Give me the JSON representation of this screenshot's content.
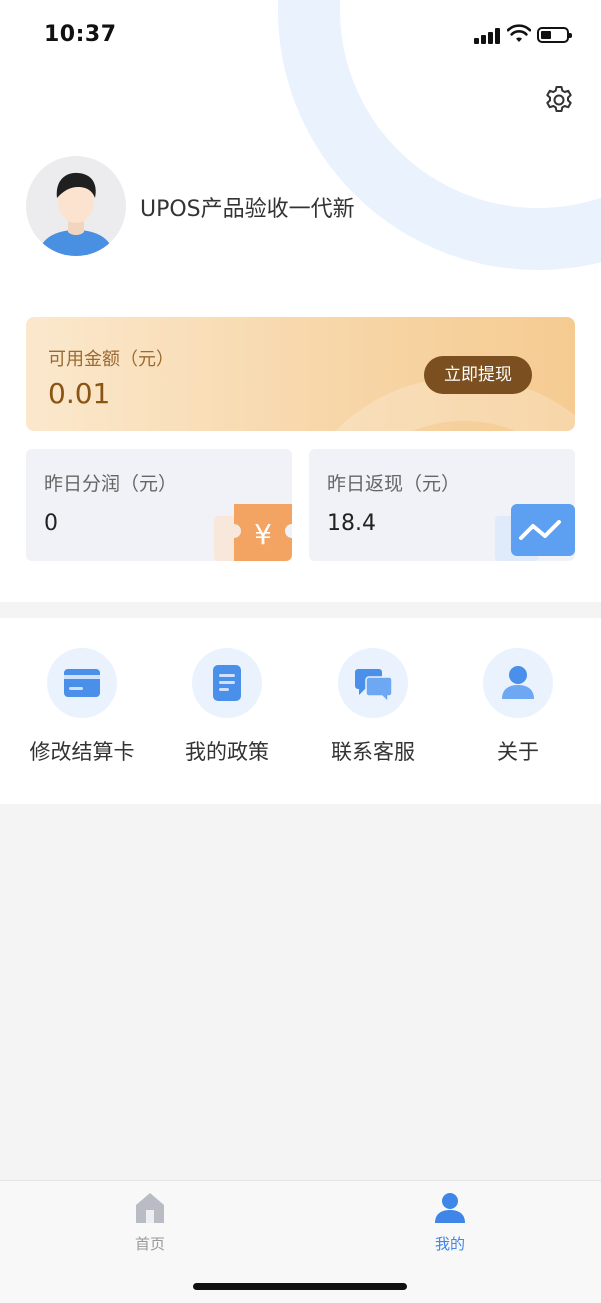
{
  "status_bar": {
    "time": "10:37"
  },
  "profile": {
    "username": "UPOS产品验收一代新"
  },
  "balance": {
    "label": "可用金额（元）",
    "value": "0.01",
    "withdraw_label": "立即提现"
  },
  "stats": [
    {
      "label": "昨日分润（元）",
      "value": "0",
      "icon": "yuan-ticket-icon"
    },
    {
      "label": "昨日返现（元）",
      "value": "18.4",
      "icon": "trend-chart-icon"
    }
  ],
  "menu": [
    {
      "label": "修改结算卡",
      "icon": "card-icon"
    },
    {
      "label": "我的政策",
      "icon": "document-icon"
    },
    {
      "label": "联系客服",
      "icon": "chat-icon"
    },
    {
      "label": "关于",
      "icon": "person-icon"
    }
  ],
  "tabbar": {
    "items": [
      {
        "label": "首页",
        "icon": "home-icon",
        "active": false
      },
      {
        "label": "我的",
        "icon": "user-icon",
        "active": true
      }
    ]
  },
  "colors": {
    "accent": "#3f86e8",
    "withdraw_button": "#7b4f1f",
    "balance_text": "#8a5412",
    "tab_inactive": "#999999"
  }
}
